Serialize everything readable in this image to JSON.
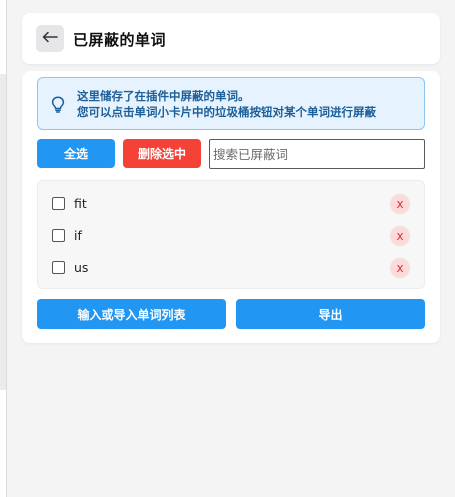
{
  "header": {
    "title": "已屏蔽的单词"
  },
  "info": {
    "line1": "这里储存了在插件中屏蔽的单词。",
    "line2": "您可以点击单词小卡片中的垃圾桶按钮对某个单词进行屏蔽"
  },
  "toolbar": {
    "select_all_label": "全选",
    "delete_selected_label": "删除选中",
    "search_placeholder": "搜索已屏蔽词",
    "search_value": ""
  },
  "words": [
    {
      "text": "fit",
      "delete_label": "x"
    },
    {
      "text": "if",
      "delete_label": "x"
    },
    {
      "text": "us",
      "delete_label": "x"
    }
  ],
  "footer": {
    "import_label": "输入或导入单词列表",
    "export_label": "导出"
  },
  "colors": {
    "primary": "#2196f3",
    "danger": "#f44336",
    "info_bg": "#e6f2fd",
    "info_text": "#1d5f99"
  },
  "icons": {
    "back": "back-arrow-icon",
    "info": "lightbulb-icon",
    "delete": "close-icon"
  }
}
